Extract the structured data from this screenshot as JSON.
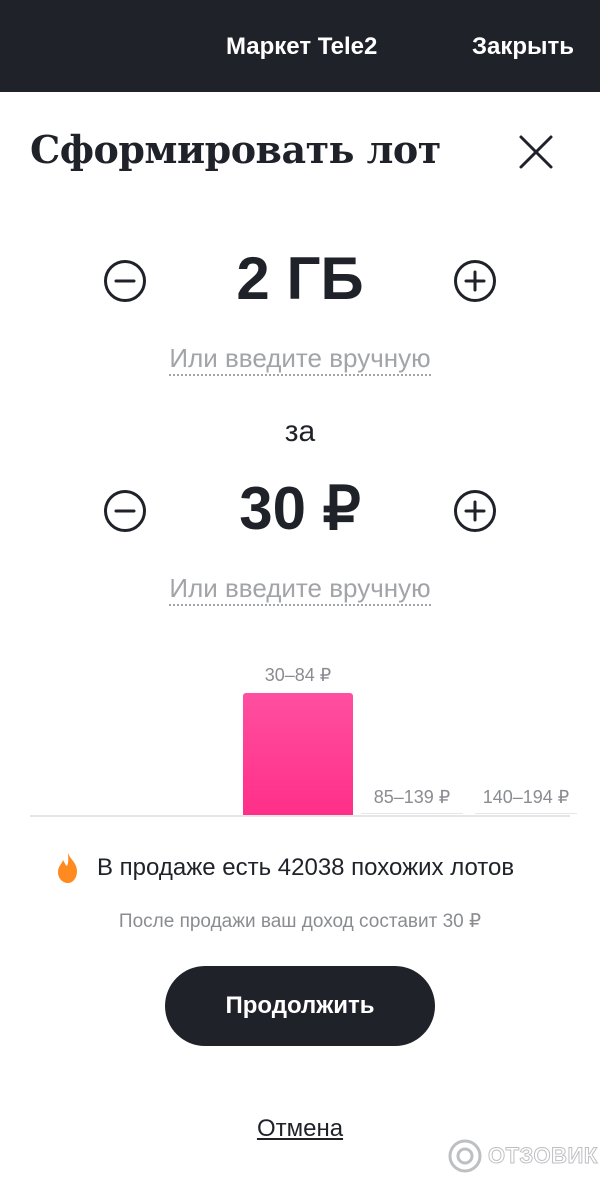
{
  "topbar": {
    "title": "Маркет Tele2",
    "close_label": "Закрыть"
  },
  "sheet": {
    "title": "Сформировать лот",
    "close_icon": "close-icon"
  },
  "data_amount": {
    "value": "2 ГБ",
    "manual_label": "Или введите вручную",
    "decrement_icon": "minus-circle-icon",
    "increment_icon": "plus-circle-icon"
  },
  "connector": "за",
  "price": {
    "value": "30 ₽",
    "manual_label": "Или введите вручную",
    "decrement_icon": "minus-circle-icon",
    "increment_icon": "plus-circle-icon"
  },
  "chart_data": {
    "type": "bar",
    "categories": [
      "30–84 ₽",
      "85–139 ₽",
      "140–194 ₽"
    ],
    "values": [
      1,
      0,
      0
    ],
    "highlight_index": 0,
    "colors": {
      "bar": "#ff3d94",
      "baseline": "#e6e6e8"
    }
  },
  "info": {
    "icon": "flame-icon",
    "text": "В продаже есть 42038 похожих лотов"
  },
  "income_text": "После продажи ваш доход составит 30 ₽",
  "continue_label": "Продолжить",
  "cancel_label": "Отмена",
  "watermark": {
    "text": "ОТЗОВИК",
    "icon": "otzovik-logo-icon"
  },
  "colors": {
    "dark": "#1f2229",
    "accent": "#ff3d94",
    "flame": "#ff8a1f",
    "muted": "#a2a4a8"
  }
}
